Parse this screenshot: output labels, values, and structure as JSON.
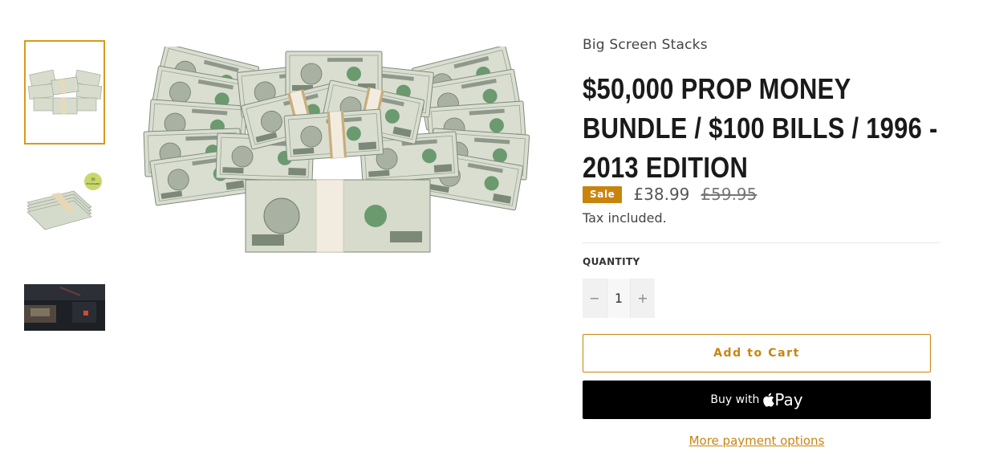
{
  "product": {
    "vendor": "Big Screen Stacks",
    "title": "$50,000 PROP MONEY BUNDLE / $100 BILLS / 1996 - 2013 EDITION",
    "sale_badge": "Sale",
    "price_current": "£38.99",
    "price_compare": "£59.95",
    "tax_note": "Tax included."
  },
  "quantity": {
    "label": "QUANTITY",
    "value": "1",
    "minus": "−",
    "plus": "+"
  },
  "actions": {
    "add_to_cart": "Add to Cart",
    "buy_with": "Buy with",
    "pay_label": "Pay",
    "more_options": "More payment options"
  },
  "colors": {
    "accent": "#c9840e",
    "selected_thumb_border": "#d59a1c",
    "buy_button_bg": "#000000"
  },
  "gallery": {
    "selected_index": 0,
    "badge_text": "50 THOUSAND"
  }
}
